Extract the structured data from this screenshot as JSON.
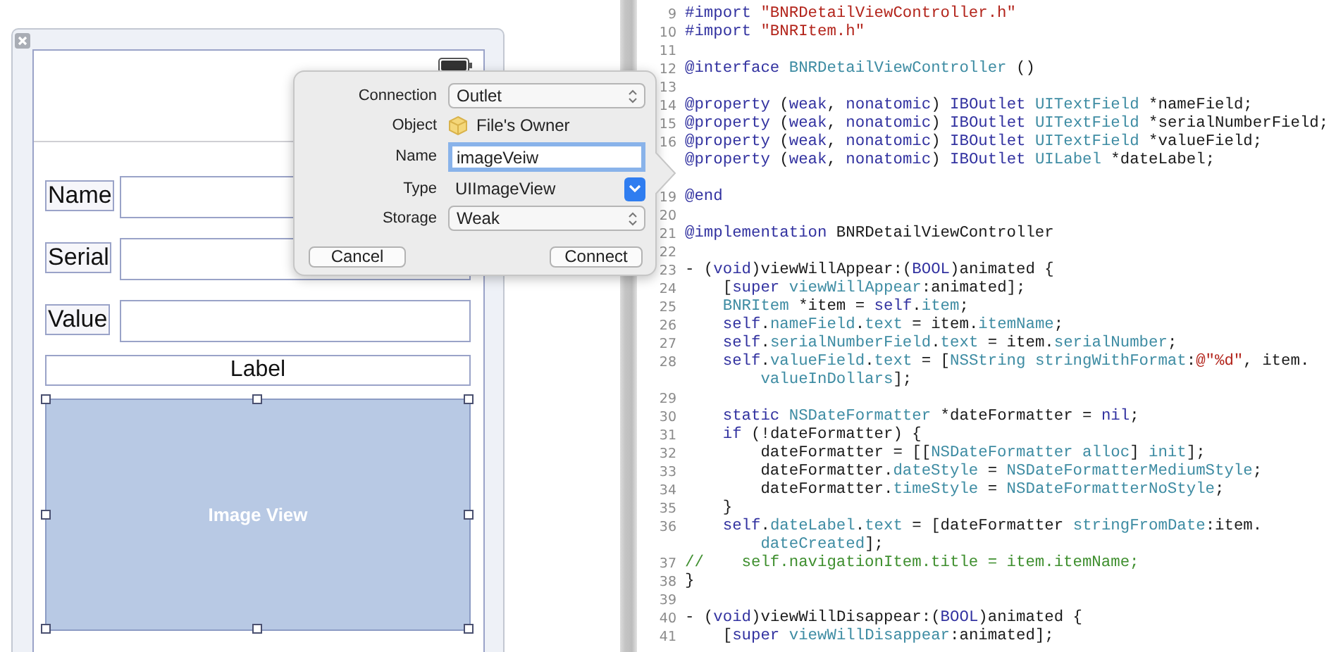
{
  "canvas": {
    "fields": [
      {
        "label": "Name"
      },
      {
        "label": "Serial"
      },
      {
        "label": "Value"
      }
    ],
    "date_label": "Label",
    "image_view": {
      "label": "Image View",
      "selected": true
    }
  },
  "connection_popover": {
    "rows": [
      {
        "label": "Connection",
        "kind": "popup",
        "value": "Outlet"
      },
      {
        "label": "Object",
        "kind": "object",
        "value": "File's Owner"
      },
      {
        "label": "Name",
        "kind": "field",
        "value": "imageVeiw",
        "focused": true
      },
      {
        "label": "Type",
        "kind": "combo",
        "value": "UIImageView"
      },
      {
        "label": "Storage",
        "kind": "popup",
        "value": "Weak"
      }
    ],
    "buttons": [
      {
        "label": "Cancel"
      },
      {
        "label": "Connect"
      }
    ]
  },
  "editor": {
    "lines": [
      {
        "number": "9",
        "segments": [
          {
            "kind": "keyword",
            "text": "#import "
          },
          {
            "kind": "string",
            "text": "\"BNRDetailViewController.h\""
          }
        ]
      },
      {
        "number": "10",
        "segments": [
          {
            "kind": "keyword",
            "text": "#import "
          },
          {
            "kind": "string",
            "text": "\"BNRItem.h\""
          }
        ]
      },
      {
        "number": "11"
      },
      {
        "number": "12",
        "segments": [
          {
            "kind": "keyword",
            "text": "@interface "
          },
          {
            "kind": "type",
            "text": "BNRDetailViewController"
          },
          {
            "kind": "plain",
            "text": " ()"
          }
        ]
      },
      {
        "number": "13"
      },
      {
        "number": "14",
        "segments": [
          {
            "kind": "keyword",
            "text": "@property "
          },
          {
            "kind": "plain",
            "text": "("
          },
          {
            "kind": "keyword",
            "text": "weak"
          },
          {
            "kind": "plain",
            "text": ", "
          },
          {
            "kind": "keyword",
            "text": "nonatomic"
          },
          {
            "kind": "plain",
            "text": ") "
          },
          {
            "kind": "keyword",
            "text": "IBOutlet "
          },
          {
            "kind": "type",
            "text": "UITextField"
          },
          {
            "kind": "plain",
            "text": " *nameField;"
          }
        ]
      },
      {
        "number": "15",
        "segments": [
          {
            "kind": "keyword",
            "text": "@property "
          },
          {
            "kind": "plain",
            "text": "("
          },
          {
            "kind": "keyword",
            "text": "weak"
          },
          {
            "kind": "plain",
            "text": ", "
          },
          {
            "kind": "keyword",
            "text": "nonatomic"
          },
          {
            "kind": "plain",
            "text": ") "
          },
          {
            "kind": "keyword",
            "text": "IBOutlet "
          },
          {
            "kind": "type",
            "text": "UITextField"
          },
          {
            "kind": "plain",
            "text": " *serialNumberField;"
          }
        ]
      },
      {
        "number": "16",
        "segments": [
          {
            "kind": "keyword",
            "text": "@property "
          },
          {
            "kind": "plain",
            "text": "("
          },
          {
            "kind": "keyword",
            "text": "weak"
          },
          {
            "kind": "plain",
            "text": ", "
          },
          {
            "kind": "keyword",
            "text": "nonatomic"
          },
          {
            "kind": "plain",
            "text": ") "
          },
          {
            "kind": "keyword",
            "text": "IBOutlet "
          },
          {
            "kind": "type",
            "text": "UITextField"
          },
          {
            "kind": "plain",
            "text": " *valueField;"
          }
        ]
      },
      {
        "segments": [
          {
            "kind": "keyword",
            "text": "@property "
          },
          {
            "kind": "plain",
            "text": "("
          },
          {
            "kind": "keyword",
            "text": "weak"
          },
          {
            "kind": "plain",
            "text": ", "
          },
          {
            "kind": "keyword",
            "text": "nonatomic"
          },
          {
            "kind": "plain",
            "text": ") "
          },
          {
            "kind": "keyword",
            "text": "IBOutlet "
          },
          {
            "kind": "type",
            "text": "UILabel"
          },
          {
            "kind": "plain",
            "text": " *dateLabel;"
          }
        ],
        "gap_after": true
      },
      {
        "number": "19",
        "segments": [
          {
            "kind": "keyword",
            "text": "@end"
          }
        ]
      },
      {
        "number": "20"
      },
      {
        "number": "21",
        "segments": [
          {
            "kind": "keyword",
            "text": "@implementation "
          },
          {
            "kind": "plain",
            "text": "BNRDetailViewController"
          }
        ]
      },
      {
        "number": "22"
      },
      {
        "number": "23",
        "segments": [
          {
            "kind": "plain",
            "text": "- ("
          },
          {
            "kind": "keyword",
            "text": "void"
          },
          {
            "kind": "plain",
            "text": ")viewWillAppear:("
          },
          {
            "kind": "keyword",
            "text": "BOOL"
          },
          {
            "kind": "plain",
            "text": ")animated {"
          }
        ]
      },
      {
        "number": "24",
        "segments": [
          {
            "kind": "plain",
            "text": "    ["
          },
          {
            "kind": "keyword",
            "text": "super "
          },
          {
            "kind": "type",
            "text": "viewWillAppear"
          },
          {
            "kind": "plain",
            "text": ":animated];"
          }
        ]
      },
      {
        "number": "25",
        "segments": [
          {
            "kind": "type",
            "text": "    BNRItem"
          },
          {
            "kind": "plain",
            "text": " *item = "
          },
          {
            "kind": "keyword",
            "text": "self"
          },
          {
            "kind": "plain",
            "text": "."
          },
          {
            "kind": "type",
            "text": "item"
          },
          {
            "kind": "plain",
            "text": ";"
          }
        ]
      },
      {
        "number": "26",
        "segments": [
          {
            "kind": "keyword",
            "text": "    self"
          },
          {
            "kind": "plain",
            "text": "."
          },
          {
            "kind": "type",
            "text": "nameField"
          },
          {
            "kind": "plain",
            "text": "."
          },
          {
            "kind": "type",
            "text": "text"
          },
          {
            "kind": "plain",
            "text": " = item."
          },
          {
            "kind": "type",
            "text": "itemName"
          },
          {
            "kind": "plain",
            "text": ";"
          }
        ]
      },
      {
        "number": "27",
        "segments": [
          {
            "kind": "keyword",
            "text": "    self"
          },
          {
            "kind": "plain",
            "text": "."
          },
          {
            "kind": "type",
            "text": "serialNumberField"
          },
          {
            "kind": "plain",
            "text": "."
          },
          {
            "kind": "type",
            "text": "text"
          },
          {
            "kind": "plain",
            "text": " = item."
          },
          {
            "kind": "type",
            "text": "serialNumber"
          },
          {
            "kind": "plain",
            "text": ";"
          }
        ]
      },
      {
        "number": "28",
        "segments": [
          {
            "kind": "keyword",
            "text": "    self"
          },
          {
            "kind": "plain",
            "text": "."
          },
          {
            "kind": "type",
            "text": "valueField"
          },
          {
            "kind": "plain",
            "text": "."
          },
          {
            "kind": "type",
            "text": "text"
          },
          {
            "kind": "plain",
            "text": " = ["
          },
          {
            "kind": "type",
            "text": "NSString stringWithFormat"
          },
          {
            "kind": "plain",
            "text": ":"
          },
          {
            "kind": "string",
            "text": "@\"%d\""
          },
          {
            "kind": "plain",
            "text": ", item."
          }
        ],
        "continuation": [
          {
            "kind": "type",
            "text": "        valueInDollars"
          },
          {
            "kind": "plain",
            "text": "];"
          }
        ]
      },
      {
        "number": "29"
      },
      {
        "number": "30",
        "segments": [
          {
            "kind": "keyword",
            "text": "    static "
          },
          {
            "kind": "type",
            "text": "NSDateFormatter"
          },
          {
            "kind": "plain",
            "text": " *dateFormatter = "
          },
          {
            "kind": "keyword",
            "text": "nil"
          },
          {
            "kind": "plain",
            "text": ";"
          }
        ]
      },
      {
        "number": "31",
        "segments": [
          {
            "kind": "keyword",
            "text": "    if"
          },
          {
            "kind": "plain",
            "text": " (!dateFormatter) {"
          }
        ]
      },
      {
        "number": "32",
        "segments": [
          {
            "kind": "plain",
            "text": "        dateFormatter = [["
          },
          {
            "kind": "type",
            "text": "NSDateFormatter alloc"
          },
          {
            "kind": "plain",
            "text": "] "
          },
          {
            "kind": "type",
            "text": "init"
          },
          {
            "kind": "plain",
            "text": "];"
          }
        ]
      },
      {
        "number": "33",
        "segments": [
          {
            "kind": "plain",
            "text": "        dateFormatter."
          },
          {
            "kind": "type",
            "text": "dateStyle"
          },
          {
            "kind": "plain",
            "text": " = "
          },
          {
            "kind": "type",
            "text": "NSDateFormatterMediumStyle"
          },
          {
            "kind": "plain",
            "text": ";"
          }
        ]
      },
      {
        "number": "34",
        "segments": [
          {
            "kind": "plain",
            "text": "        dateFormatter."
          },
          {
            "kind": "type",
            "text": "timeStyle"
          },
          {
            "kind": "plain",
            "text": " = "
          },
          {
            "kind": "type",
            "text": "NSDateFormatterNoStyle"
          },
          {
            "kind": "plain",
            "text": ";"
          }
        ]
      },
      {
        "number": "35",
        "segments": [
          {
            "kind": "plain",
            "text": "    }"
          }
        ]
      },
      {
        "number": "36",
        "segments": [
          {
            "kind": "keyword",
            "text": "    self"
          },
          {
            "kind": "plain",
            "text": "."
          },
          {
            "kind": "type",
            "text": "dateLabel"
          },
          {
            "kind": "plain",
            "text": "."
          },
          {
            "kind": "type",
            "text": "text"
          },
          {
            "kind": "plain",
            "text": " = [dateFormatter "
          },
          {
            "kind": "type",
            "text": "stringFromDate"
          },
          {
            "kind": "plain",
            "text": ":item."
          }
        ],
        "continuation": [
          {
            "kind": "type",
            "text": "        dateCreated"
          },
          {
            "kind": "plain",
            "text": "];"
          }
        ]
      },
      {
        "number": "37",
        "segments": [
          {
            "kind": "comment",
            "text": "//    self.navigationItem.title = item.itemName;"
          }
        ]
      },
      {
        "number": "38",
        "segments": [
          {
            "kind": "plain",
            "text": "}"
          }
        ]
      },
      {
        "number": "39"
      },
      {
        "number": "40",
        "segments": [
          {
            "kind": "plain",
            "text": "- ("
          },
          {
            "kind": "keyword",
            "text": "void"
          },
          {
            "kind": "plain",
            "text": ")viewWillDisappear:("
          },
          {
            "kind": "keyword",
            "text": "BOOL"
          },
          {
            "kind": "plain",
            "text": ")animated {"
          }
        ]
      },
      {
        "number": "41",
        "segments": [
          {
            "kind": "plain",
            "text": "    ["
          },
          {
            "kind": "keyword",
            "text": "super "
          },
          {
            "kind": "type",
            "text": "viewWillDisappear"
          },
          {
            "kind": "plain",
            "text": ":animated];"
          }
        ]
      }
    ]
  }
}
